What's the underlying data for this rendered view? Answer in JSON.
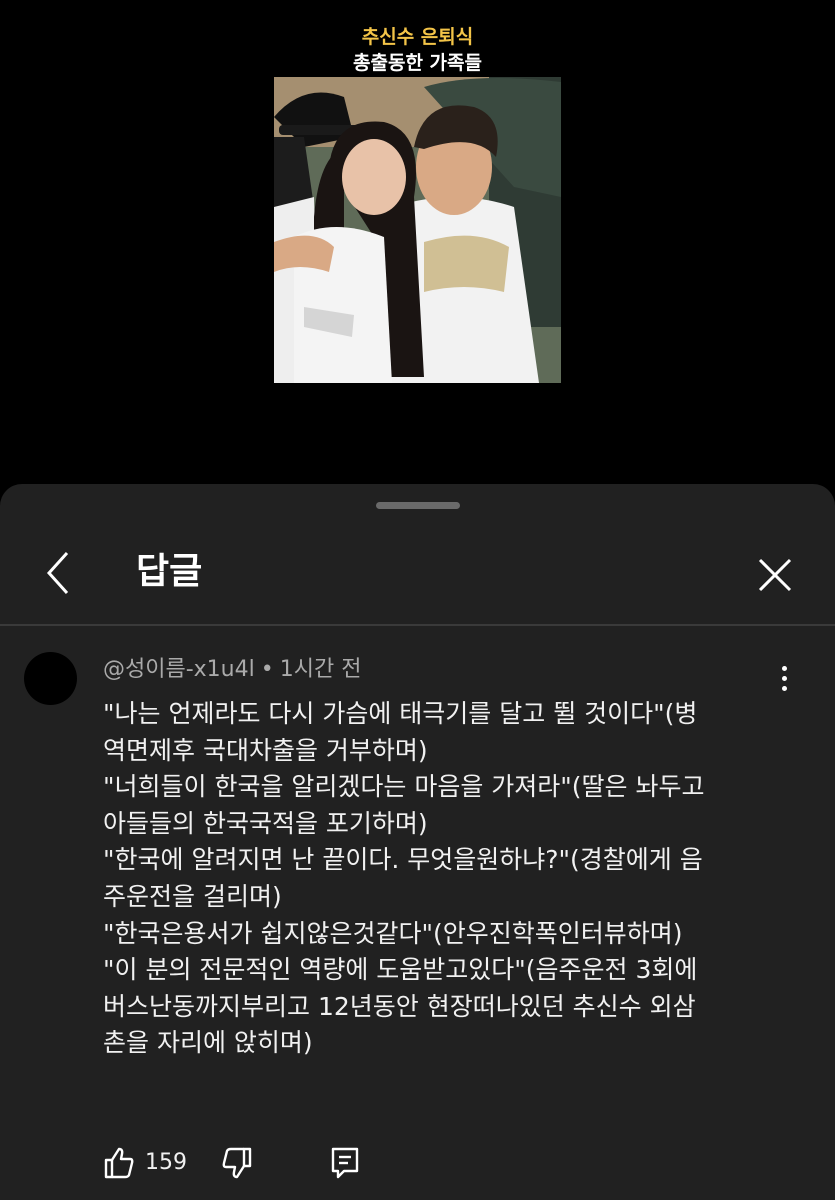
{
  "video": {
    "title_line1": "추신수 은퇴식",
    "title_line2": "총출동한 가족들"
  },
  "sheet": {
    "title": "답글",
    "back_icon": "chevron-left-icon",
    "close_icon": "close-icon"
  },
  "comment": {
    "author": "@성이름-x1u4l",
    "separator": "•",
    "time": "1시간 전",
    "lines": [
      "\"나는 언제라도 다시 가슴에 태극기를 달고 뛸 것이다\"(병",
      "역면제후 국대차출을 거부하며)",
      "\"너희들이 한국을 알리겠다는 마음을 가져라\"(딸은 놔두고",
      "아들들의 한국국적을 포기하며)",
      "\"한국에 알려지면 난 끝이다. 무엇을원하냐?\"(경찰에게 음",
      "주운전을 걸리며)",
      "\"한국은용서가 쉽지않은것같다\"(안우진학폭인터뷰하며)",
      "\"이 분의 전문적인 역량에 도움받고있다\"(음주운전 3회에",
      "버스난동까지부리고 12년동안 현장떠나있던 추신수 외삼",
      "촌을 자리에 앉히며)"
    ],
    "likes": "159"
  },
  "colors": {
    "title_accent": "#f3c448",
    "sheet_bg": "#212121",
    "meta_text": "#aaaaaa"
  }
}
